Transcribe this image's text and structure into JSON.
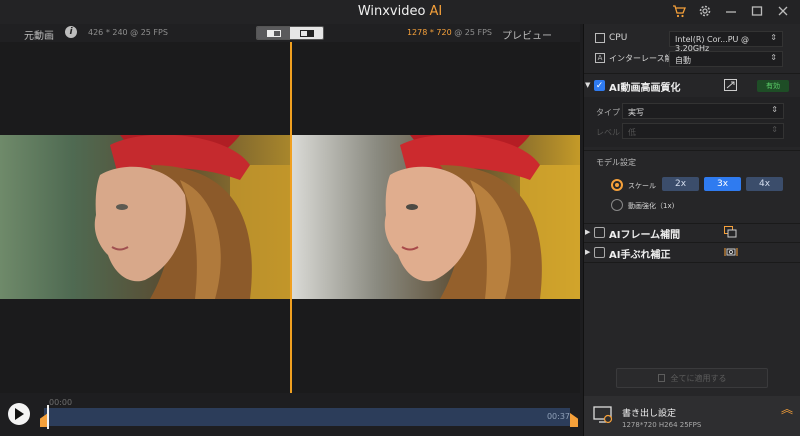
{
  "app": {
    "title": "Winxvideo",
    "title_ai": "AI"
  },
  "header_icons": [
    "cart-icon",
    "gear-icon",
    "minimize-icon",
    "maximize-icon",
    "close-icon"
  ],
  "preview": {
    "original_label": "元動画",
    "original_info": "426 * 240 @ 25 FPS",
    "preview_resolution": "1278 * 720",
    "preview_fps": " @ 25 FPS",
    "preview_label": "プレビュー"
  },
  "timeline": {
    "start_time": "00:00",
    "end_time": "00:37"
  },
  "panel": {
    "cpu_label": "CPU",
    "cpu_value": "Intel(R) Cor...PU @ 3.20GHz",
    "deinterlace_label": "インターレース解除",
    "deinterlace_value": "自動",
    "enhance": {
      "title": "AI動画高画質化",
      "checked": true,
      "status": "有効",
      "type_label": "タイプ",
      "type_value": "実写",
      "level_label": "レベル",
      "level_value": "低",
      "model_label": "モデル設定",
      "scale_label": "スケール",
      "scale_options": [
        "2x",
        "3x",
        "4x"
      ],
      "scale_selected": "3x",
      "enhance_option": "動画強化（1x)"
    },
    "frame_interp": {
      "title": "AIフレーム補間",
      "checked": false
    },
    "stabilize": {
      "title": "AI手ぶれ補正",
      "checked": false
    },
    "apply_all": "全てに適用する",
    "export": {
      "title": "書き出し設定",
      "info": "1278*720   H264   25FPS"
    }
  },
  "colors": {
    "accent": "#f5a03a",
    "blue": "#2f7bf0",
    "enabled_green": "#5cd16a"
  }
}
